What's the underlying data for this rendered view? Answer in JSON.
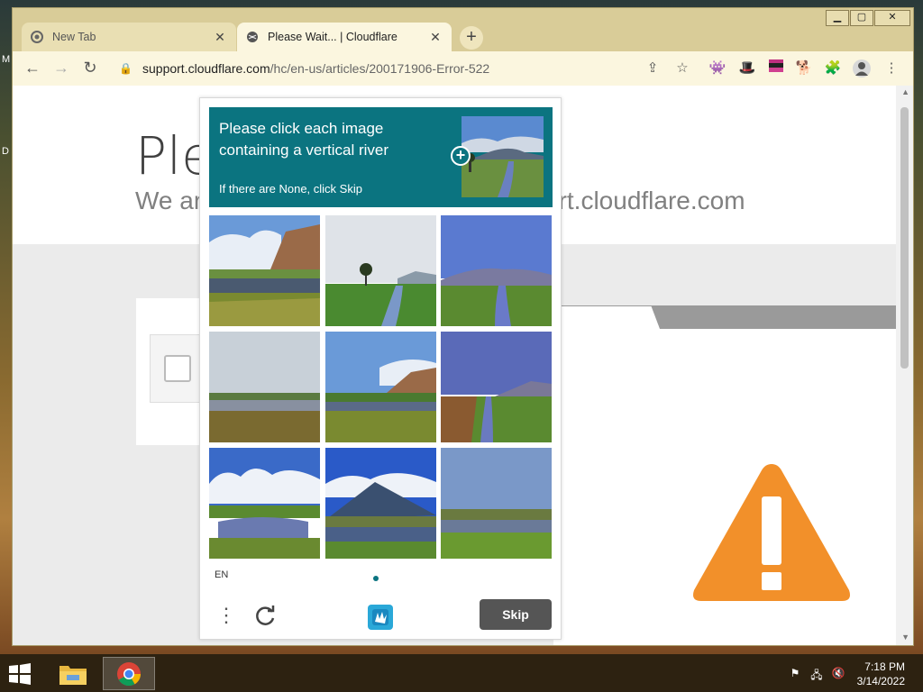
{
  "browser": {
    "tabs": [
      {
        "title": "New Tab",
        "favicon": "chrome-icon"
      },
      {
        "title": "Please Wait... | Cloudflare",
        "favicon": "globe-icon"
      }
    ],
    "url_host": "support.cloudflare.com",
    "url_path": "/hc/en-us/articles/200171906-Error-522"
  },
  "page": {
    "heading": "Ple",
    "subheading_left": "We ar",
    "subheading_right": "ort.cloudflare.com"
  },
  "captcha": {
    "prompt": "Please click each image containing a vertical river",
    "hint": "If there are None, click Skip",
    "language": "EN",
    "skip_label": "Skip",
    "accent_color": "#0b7480",
    "tiles": [
      "mountain-lake",
      "tree-river",
      "vertical-river",
      "cloudy-lake",
      "mountain-lake",
      "vertical-river",
      "cloud-lake",
      "volcano-lake",
      "flat-lake"
    ]
  },
  "taskbar": {
    "time": "7:18 PM",
    "date": "3/14/2022"
  }
}
